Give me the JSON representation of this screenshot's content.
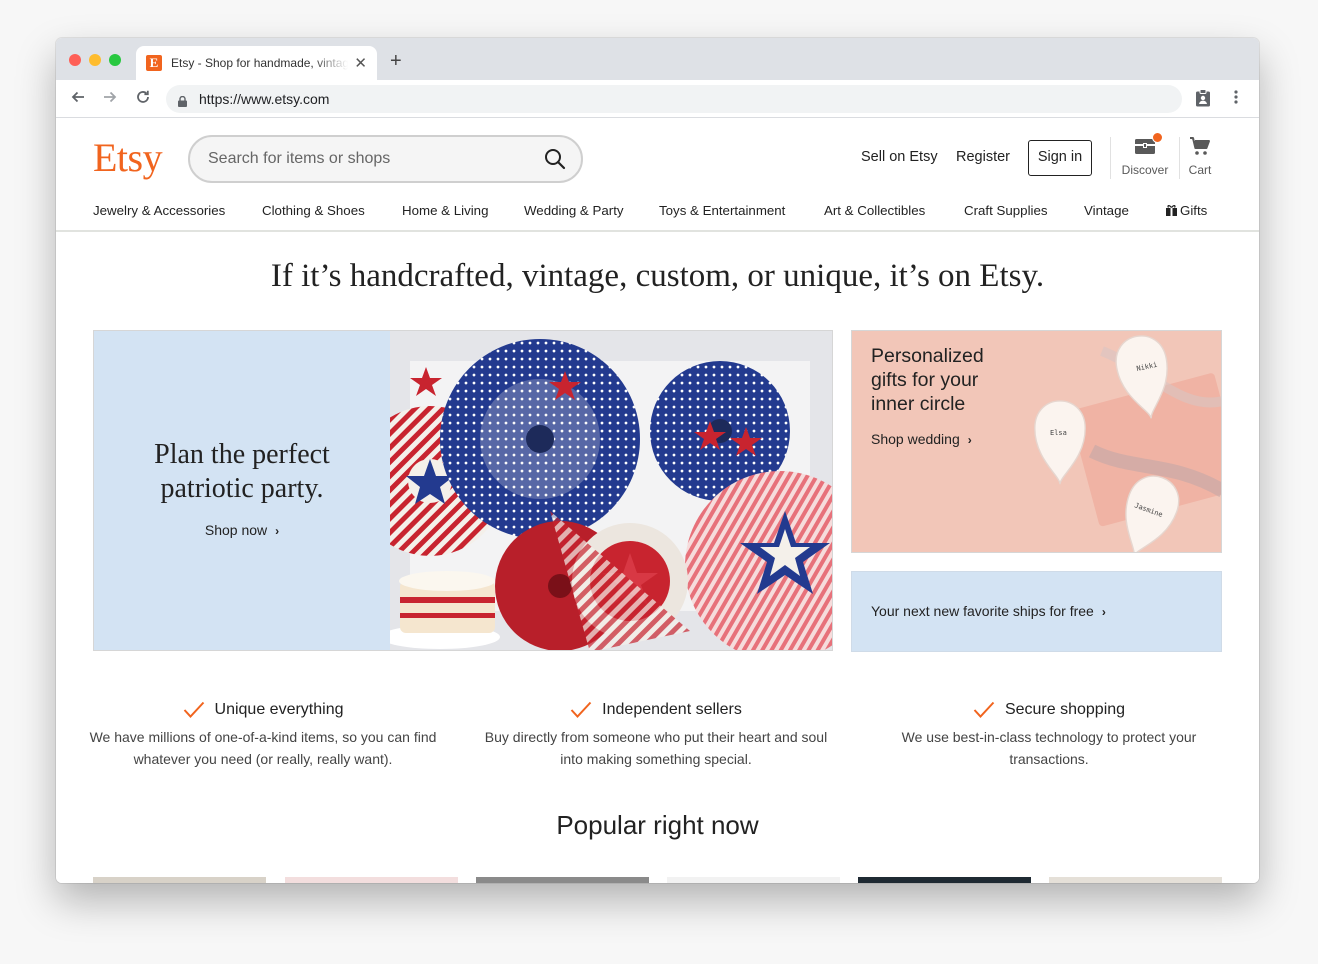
{
  "browser": {
    "tab_title": "Etsy - Shop for handmade, vintage, custom, and unique gifts",
    "url": "https://www.etsy.com"
  },
  "header": {
    "logo": "Etsy",
    "search_placeholder": "Search for items or shops",
    "sell_label": "Sell on Etsy",
    "register_label": "Register",
    "signin_label": "Sign in",
    "discover_label": "Discover",
    "cart_label": "Cart"
  },
  "categories": [
    "Jewelry & Accessories",
    "Clothing & Shoes",
    "Home & Living",
    "Wedding & Party",
    "Toys & Entertainment",
    "Art & Collectibles",
    "Craft Supplies",
    "Vintage",
    "Gifts"
  ],
  "headline": "If it’s handcrafted, vintage, custom, or unique, it’s on Etsy.",
  "hero": {
    "title": "Plan the perfect patriotic party.",
    "link": "Shop now"
  },
  "promo_gifts": {
    "title": "Personalized gifts for your inner circle",
    "link": "Shop wedding",
    "dish_names": [
      "Nikki",
      "Elsa",
      "Jasmine"
    ]
  },
  "promo_shipping": {
    "link": "Your next new favorite ships for free"
  },
  "value_props": [
    {
      "title": "Unique everything",
      "body": "We have millions of one-of-a-kind items, so you can find whatever you need (or really, really want)."
    },
    {
      "title": "Independent sellers",
      "body": "Buy directly from someone who put their heart and soul into making something special."
    },
    {
      "title": "Secure shopping",
      "body": "We use best-in-class technology to protect your transactions."
    }
  ],
  "popular_title": "Popular right now",
  "colors": {
    "brand": "#f1641e",
    "hero_bg": "#d3e3f3",
    "check": "#f1641e"
  }
}
